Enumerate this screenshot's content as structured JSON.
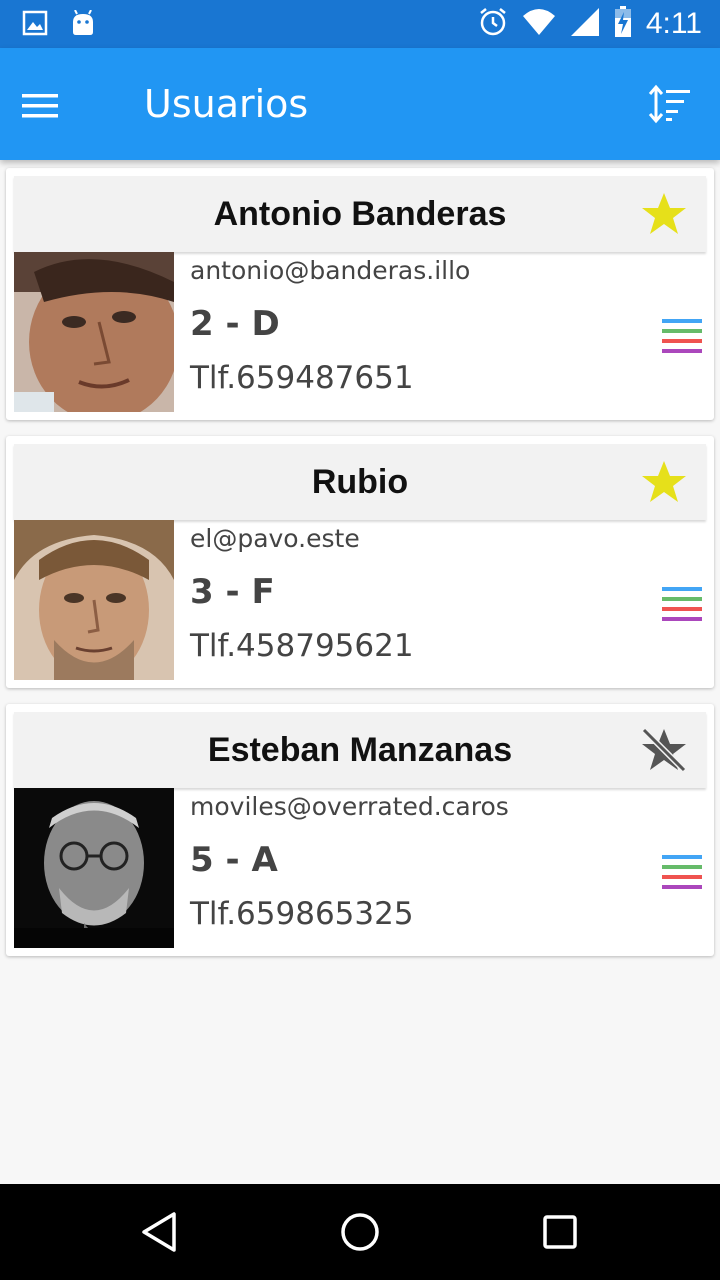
{
  "status_bar": {
    "time": "4:11",
    "icons": [
      "image-icon",
      "android-icon",
      "alarm-icon",
      "wifi-icon",
      "signal-icon",
      "battery-charging-icon"
    ]
  },
  "app_bar": {
    "title": "Usuarios",
    "menu_icon": "hamburger-menu-icon",
    "sort_icon": "sort-icon"
  },
  "users": [
    {
      "name": "Antonio Banderas",
      "email": "antonio@banderas.illo",
      "level": "2 - D",
      "phone": "Tlf.659487651",
      "favorite": true
    },
    {
      "name": "Rubio",
      "email": "el@pavo.este",
      "level": "3 - F",
      "phone": "Tlf.458795621",
      "favorite": true
    },
    {
      "name": "Esteban Manzanas",
      "email": "moviles@overrated.caros",
      "level": "5 - A",
      "phone": "Tlf.659865325",
      "favorite": false
    }
  ],
  "colors": {
    "status_bar": "#1976d2",
    "app_bar": "#2196f3",
    "star_on": "#e6e01a",
    "star_off": "#555555",
    "line_blue": "#42a5f5",
    "line_green": "#66bb6a",
    "line_red": "#ef5350",
    "line_purple": "#ab47bc"
  },
  "nav_bar": {
    "icons": [
      "back-icon",
      "home-icon",
      "recents-icon"
    ]
  }
}
